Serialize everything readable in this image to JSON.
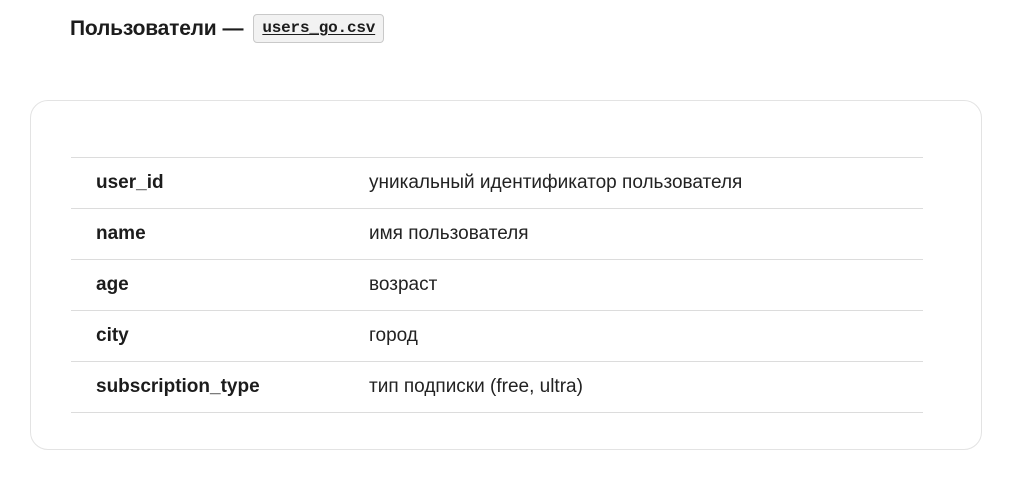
{
  "header": {
    "title": "Пользователи",
    "separator": "—",
    "file_name": "users_go.csv"
  },
  "fields": [
    {
      "name": "user_id",
      "description": "уникальный идентификатор пользователя"
    },
    {
      "name": "name",
      "description": "имя пользователя"
    },
    {
      "name": "age",
      "description": "возраст"
    },
    {
      "name": "city",
      "description": "город"
    },
    {
      "name": "subscription_type",
      "description": "тип подписки (free, ultra)"
    }
  ]
}
